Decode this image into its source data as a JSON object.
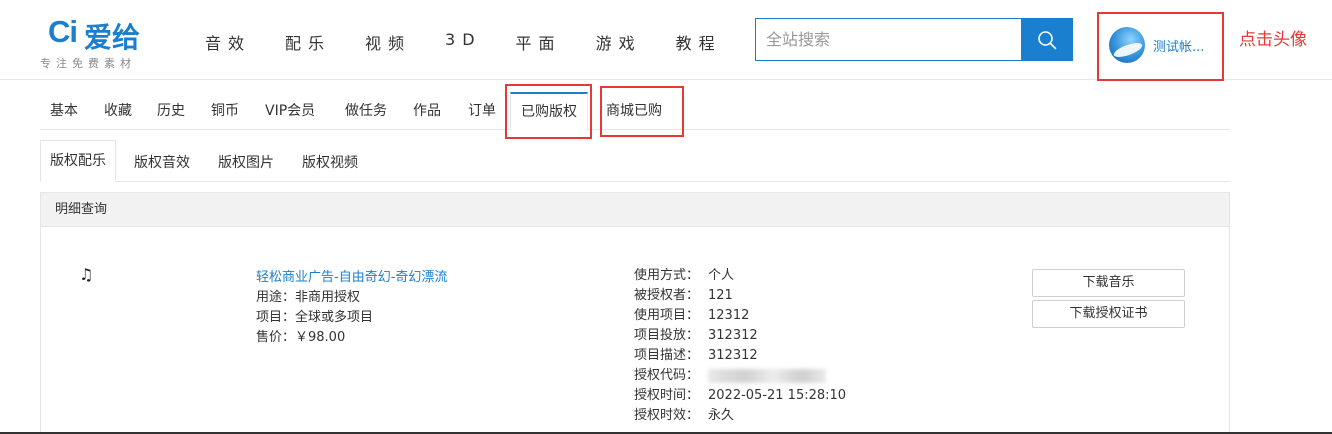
{
  "colors": {
    "brand": "#1b7fd0",
    "annotation": "#e53935",
    "border": "#e6e6e6"
  },
  "header": {
    "logo_mark": "Ci",
    "logo_name": "爱给",
    "logo_slogan": "专注免费素材",
    "nav": [
      "音效",
      "配乐",
      "视频",
      "3D",
      "平面",
      "游戏",
      "教程"
    ],
    "search_placeholder": "全站搜索",
    "search_icon": "search-icon",
    "username": "测试帐...",
    "annotation": "点击头像"
  },
  "account_tabs": [
    "基本",
    "收藏",
    "历史",
    "铜币",
    "VIP会员",
    "做任务",
    "作品",
    "订单",
    "已购版权",
    "商城已购"
  ],
  "account_tab_active": "已购版权",
  "sub_tabs": [
    "版权配乐",
    "版权音效",
    "版权图片",
    "版权视频"
  ],
  "sub_tab_active": "版权配乐",
  "panel": {
    "title": "明细查询",
    "item": {
      "icon": "music-note-icon",
      "name": "轻松商业广告-自由奇幻-奇幻漂流",
      "usage": "用途：非商用授权",
      "project": "项目：全球或多项目",
      "price": "售价：￥98.00",
      "details": [
        {
          "k": "使用方式：",
          "v": "个人"
        },
        {
          "k": "被授权者：",
          "v": "121"
        },
        {
          "k": "使用项目：",
          "v": "12312"
        },
        {
          "k": "项目投放：",
          "v": "312312"
        },
        {
          "k": "项目描述：",
          "v": "312312"
        },
        {
          "k": "授权代码：",
          "v": ""
        },
        {
          "k": "授权时间：",
          "v": "2022-05-21 15:28:10"
        },
        {
          "k": "授权时效：",
          "v": "永久"
        }
      ],
      "btn_download_music": "下载音乐",
      "btn_download_cert": "下载授权证书"
    }
  }
}
